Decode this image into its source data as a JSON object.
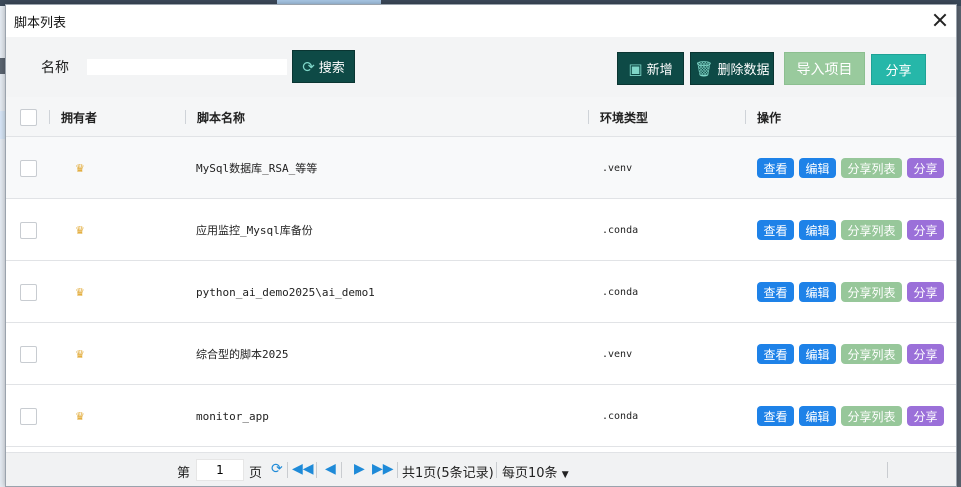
{
  "dialog": {
    "title": "脚本列表"
  },
  "toolbar": {
    "name_label": "名称",
    "name_value": "",
    "search_label": "搜索",
    "add_label": "新增",
    "delete_label": "删除数据",
    "import_label": "导入项目",
    "share_label": "分享"
  },
  "table": {
    "headers": {
      "owner": "拥有者",
      "script_name": "脚本名称",
      "env_type": "环境类型",
      "actions": "操作"
    },
    "rows": [
      {
        "name": "MySql数据库_RSA_等等",
        "env": ".venv"
      },
      {
        "name": "应用监控_Mysql库备份",
        "env": ".conda"
      },
      {
        "name": "python_ai_demo2025\\ai_demo1",
        "env": ".conda"
      },
      {
        "name": "综合型的脚本2025",
        "env": ".venv"
      },
      {
        "name": "monitor_app",
        "env": ".conda"
      }
    ],
    "actions": {
      "view": "查看",
      "edit": "编辑",
      "share_list": "分享列表",
      "share": "分享"
    }
  },
  "pager": {
    "page_prefix": "第",
    "page_value": "1",
    "page_suffix": "页",
    "summary": "共1页(5条记录)",
    "per_page": "每页10条"
  },
  "colors": {
    "dark_button": "#0e4a46",
    "primary": "#1e82e8",
    "share_list": "#97c79a",
    "share": "#9b70d9",
    "teal": "#26b7a9"
  }
}
